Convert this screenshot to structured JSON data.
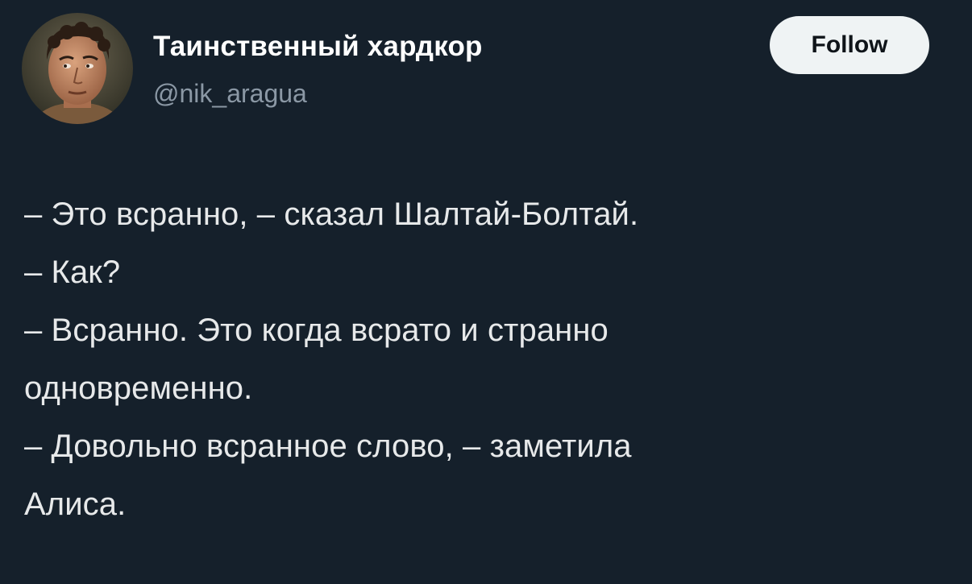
{
  "author": {
    "display_name": "Таинственный хардкор",
    "handle": "@nik_aragua",
    "avatar_icon": "person-photo-avatar"
  },
  "follow_button": {
    "label": "Follow"
  },
  "tweet": {
    "lines": [
      "– Это всранно, – сказал Шалтай-Болтай.",
      "– Как?",
      "– Всранно. Это когда всрато и странно",
      "одновременно.",
      "– Довольно всранное слово, – заметила",
      "Алиса."
    ]
  },
  "colors": {
    "background": "#15202b",
    "text": "#e7e9ea",
    "secondary_text": "#8b98a5",
    "follow_button_bg": "#eff3f4",
    "follow_button_text": "#0f1419"
  }
}
